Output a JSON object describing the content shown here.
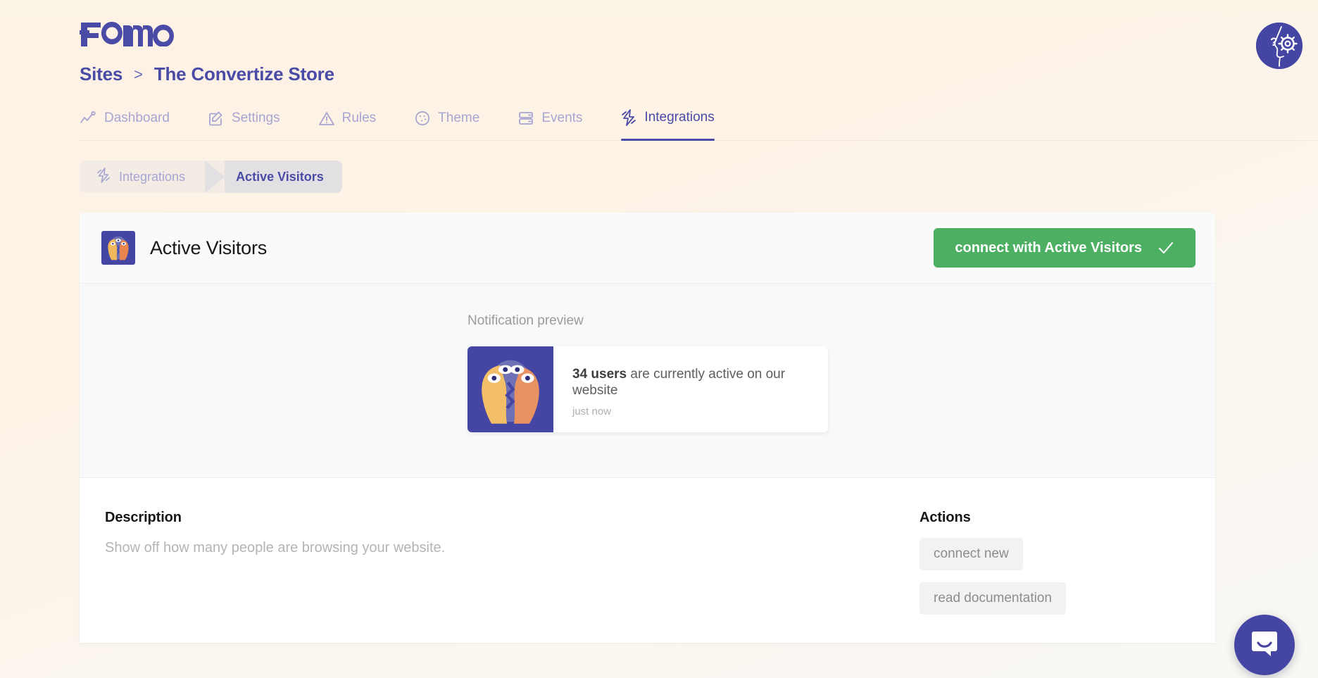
{
  "brand": {
    "logo_text": "Fomo",
    "accent_indigo": "#4a4ba6",
    "accent_green": "#4caf62",
    "page_bg": "#fdf3e7"
  },
  "header": {
    "breadcrumb_root": "Sites",
    "breadcrumb_separator": ">",
    "site_name": "The Convertize Store"
  },
  "tabs": [
    {
      "label": "Dashboard",
      "icon": "line-chart-icon",
      "active": false
    },
    {
      "label": "Settings",
      "icon": "pencil-square-icon",
      "active": false
    },
    {
      "label": "Rules",
      "icon": "warning-triangle-icon",
      "active": false
    },
    {
      "label": "Theme",
      "icon": "palette-icon",
      "active": false
    },
    {
      "label": "Events",
      "icon": "stacked-bars-icon",
      "active": false
    },
    {
      "label": "Integrations",
      "icon": "lightning-bolt-icon",
      "active": true
    }
  ],
  "subnav": {
    "parent": "Integrations",
    "parent_icon": "lightning-bolt-icon",
    "current": "Active Visitors"
  },
  "integration": {
    "title": "Active Visitors",
    "icon": "active-visitors-faces-icon",
    "connect_label": "connect with Active Visitors",
    "connect_check": "check-icon"
  },
  "preview": {
    "label": "Notification preview",
    "highlight": "34 users",
    "message": " are currently active on our website",
    "timestamp": "just now"
  },
  "description": {
    "heading": "Description",
    "body": "Show off how many people are browsing your website."
  },
  "actions": {
    "heading": "Actions",
    "buttons": [
      {
        "label": "connect new"
      },
      {
        "label": "read documentation"
      }
    ]
  },
  "floating": {
    "help_icon": "help-face-gear-icon",
    "chat_icon": "chat-smile-bubble-icon"
  }
}
